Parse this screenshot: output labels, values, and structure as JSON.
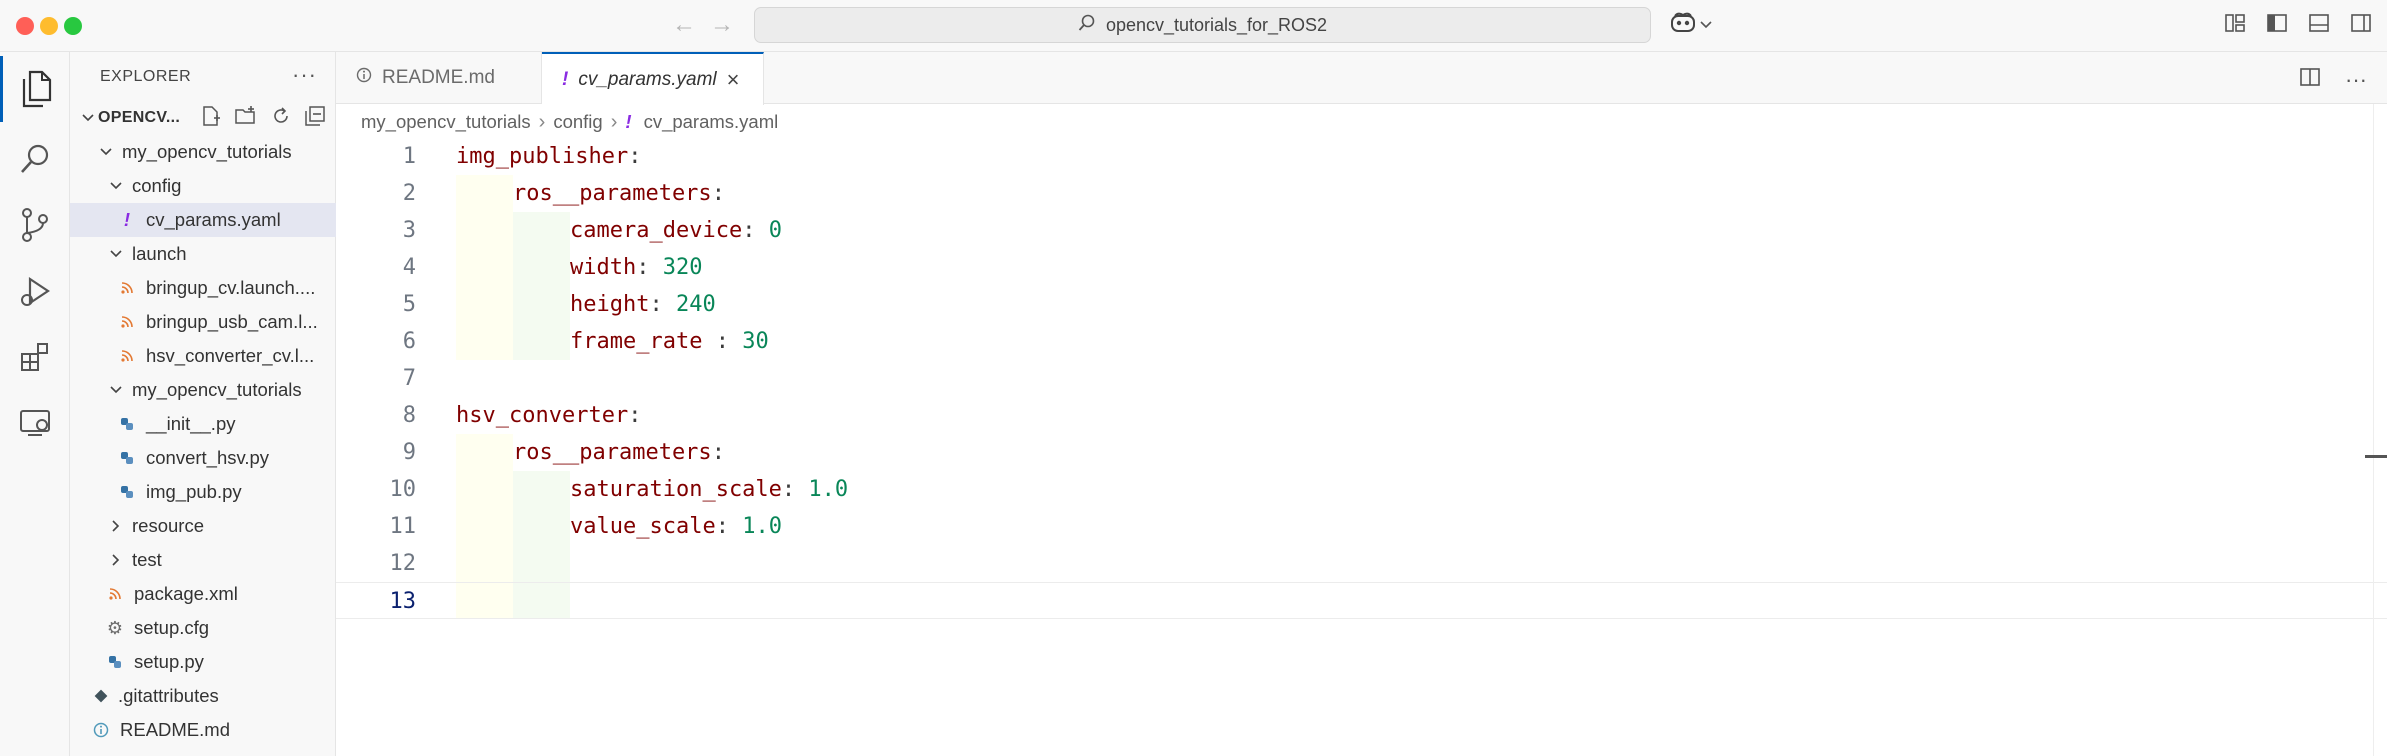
{
  "window": {
    "search_text": "opencv_tutorials_for_ROS2"
  },
  "explorer": {
    "title": "EXPLORER",
    "more": "···",
    "root_label": "OPENCV...",
    "tree": [
      {
        "label": "my_opencv_tutorials",
        "type": "folder-open"
      },
      {
        "label": "config",
        "type": "folder-open"
      },
      {
        "label": "cv_params.yaml",
        "type": "yaml"
      },
      {
        "label": "launch",
        "type": "folder-open"
      },
      {
        "label": "bringup_cv.launch....",
        "type": "rss"
      },
      {
        "label": "bringup_usb_cam.l...",
        "type": "rss"
      },
      {
        "label": "hsv_converter_cv.l...",
        "type": "rss"
      },
      {
        "label": "my_opencv_tutorials",
        "type": "folder-open"
      },
      {
        "label": "__init__.py",
        "type": "python"
      },
      {
        "label": "convert_hsv.py",
        "type": "python"
      },
      {
        "label": "img_pub.py",
        "type": "python"
      },
      {
        "label": "resource",
        "type": "folder-closed"
      },
      {
        "label": "test",
        "type": "folder-closed"
      },
      {
        "label": "package.xml",
        "type": "rss"
      },
      {
        "label": "setup.cfg",
        "type": "gear"
      },
      {
        "label": "setup.py",
        "type": "python"
      },
      {
        "label": ".gitattributes",
        "type": "git"
      },
      {
        "label": "README.md",
        "type": "info"
      }
    ]
  },
  "tabs": [
    {
      "label": "README.md",
      "icon": "info-icon",
      "active": false
    },
    {
      "label": "cv_params.yaml",
      "icon": "yaml-icon",
      "active": true,
      "close": "×"
    }
  ],
  "breadcrumb": [
    "my_opencv_tutorials",
    "config",
    "cv_params.yaml"
  ],
  "editor": {
    "lines": [
      {
        "n": "1",
        "key": "img_publisher",
        "colon": ":",
        "value": ""
      },
      {
        "n": "2",
        "key": "ros__parameters",
        "colon": ":",
        "value": ""
      },
      {
        "n": "3",
        "key": "camera_device",
        "colon": ": ",
        "value": "0"
      },
      {
        "n": "4",
        "key": "width",
        "colon": ": ",
        "value": "320"
      },
      {
        "n": "5",
        "key": "height",
        "colon": ": ",
        "value": "240"
      },
      {
        "n": "6",
        "key": "frame_rate",
        "colon": " : ",
        "value": "30"
      },
      {
        "n": "7",
        "key": "",
        "colon": "",
        "value": ""
      },
      {
        "n": "8",
        "key": "hsv_converter",
        "colon": ":",
        "value": ""
      },
      {
        "n": "9",
        "key": "ros__parameters",
        "colon": ":",
        "value": ""
      },
      {
        "n": "10",
        "key": "saturation_scale",
        "colon": ": ",
        "value": "1.0"
      },
      {
        "n": "11",
        "key": "value_scale",
        "colon": ": ",
        "value": "1.0"
      },
      {
        "n": "12",
        "key": "",
        "colon": "",
        "value": ""
      },
      {
        "n": "13",
        "key": "",
        "colon": "",
        "value": ""
      }
    ]
  },
  "colors": {
    "accent": "#005fb8",
    "yaml_key": "#800000",
    "yaml_number": "#098658",
    "selection": "#e4e6f1"
  }
}
